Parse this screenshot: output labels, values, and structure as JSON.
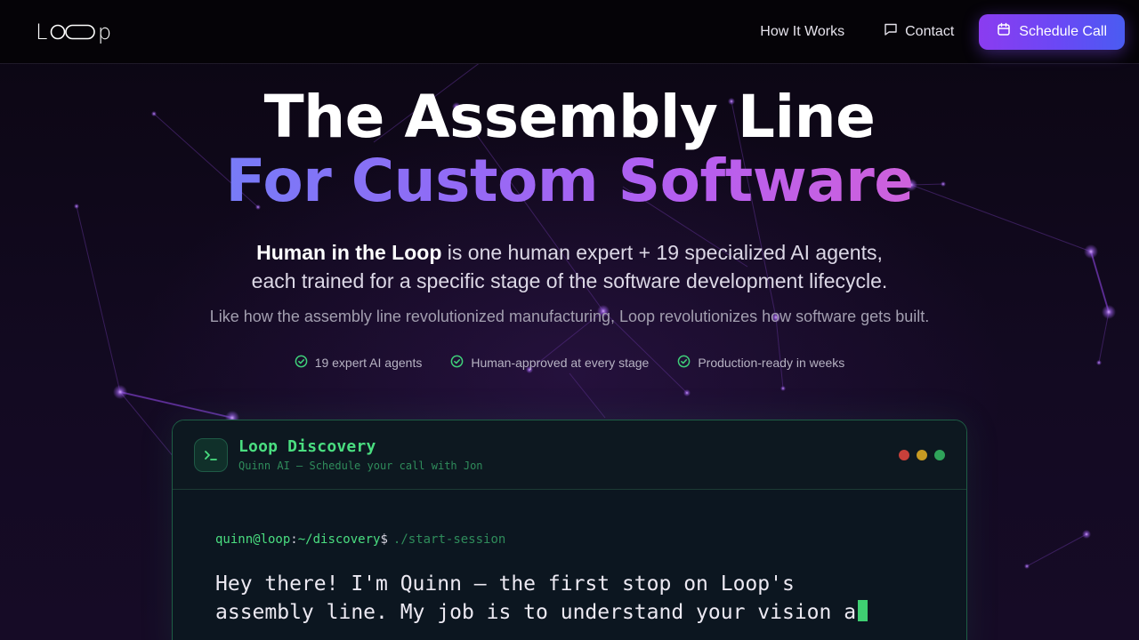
{
  "nav": {
    "logo_prefix": "L",
    "logo_suffix": "p",
    "links": [
      {
        "label": "How It Works"
      },
      {
        "label": "Contact",
        "icon": "chat-bubble-icon"
      }
    ],
    "cta": {
      "label": "Schedule Call",
      "icon": "calendar-icon"
    }
  },
  "hero": {
    "title_line1": "The Assembly Line",
    "title_line2": "For Custom Software",
    "subtitle_bold": "Human in the Loop",
    "subtitle_rest": " is one human expert + 19 specialized AI agents,",
    "subtitle_line2": "each trained for a specific stage of the software development lifecycle.",
    "tagline": "Like how the assembly line revolutionized manufacturing, Loop revolutionizes how software gets built.",
    "checks": [
      "19 expert AI agents",
      "Human-approved at every stage",
      "Production-ready in weeks"
    ]
  },
  "terminal": {
    "title": "Loop Discovery",
    "subtitle": "Quinn AI — Schedule your call with Jon",
    "prompt_user": "quinn@loop",
    "prompt_sep": ":",
    "prompt_path": "~/discovery",
    "prompt_symbol": "$",
    "command": "./start-session",
    "message_line1": "Hey there! I'm Quinn — the first stop on Loop's",
    "message_line2": "assembly line. My job is to understand your vision a",
    "dot_colors": [
      "#c8403a",
      "#c79a22",
      "#2fa35a"
    ]
  },
  "colors": {
    "accent_green": "#4ade80",
    "cta_gradient_start": "#8b3cf0",
    "cta_gradient_end": "#4a5cf2"
  }
}
